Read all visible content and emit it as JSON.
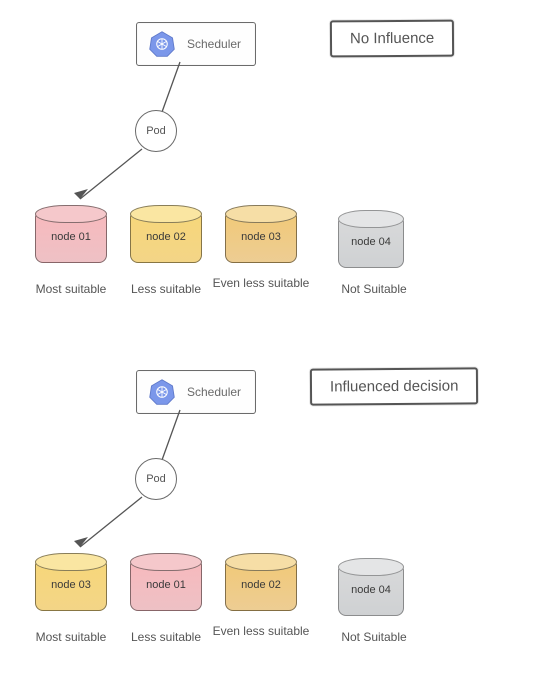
{
  "diagrams": [
    {
      "title": "No Influence",
      "scheduler_label": "Scheduler",
      "pod_label": "Pod",
      "nodes": [
        {
          "label": "node 01",
          "color": "red",
          "caption": "Most suitable"
        },
        {
          "label": "node 02",
          "color": "yellow",
          "caption": "Less suitable"
        },
        {
          "label": "node 03",
          "color": "amber",
          "caption": "Even less suitable"
        },
        {
          "label": "node 04",
          "color": "grey",
          "caption": "Not Suitable"
        }
      ]
    },
    {
      "title": "Influenced decision",
      "scheduler_label": "Scheduler",
      "pod_label": "Pod",
      "nodes": [
        {
          "label": "node 03",
          "color": "yellow",
          "caption": "Most suitable"
        },
        {
          "label": "node 01",
          "color": "red",
          "caption": "Less suitable"
        },
        {
          "label": "node 02",
          "color": "amber",
          "caption": "Even less suitable"
        },
        {
          "label": "node 04",
          "color": "grey",
          "caption": "Not Suitable"
        }
      ]
    }
  ],
  "icon": "kubernetes-icon",
  "colors": {
    "red": "#f3b6ba",
    "yellow": "#f6d77e",
    "amber": "#f0ca80",
    "grey": "#d6d7d9",
    "stroke": "#5a5a5a",
    "hex": "#6a8de8"
  }
}
